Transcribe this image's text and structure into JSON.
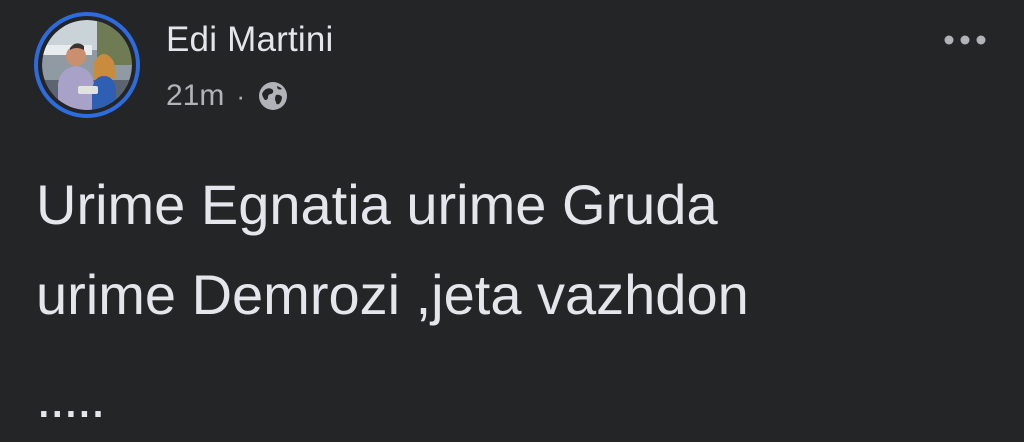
{
  "post": {
    "author": {
      "name": "Edi Martini",
      "avatar_icon": "profile-photo"
    },
    "meta": {
      "time": "21m",
      "separator": "·",
      "audience_icon": "globe-icon"
    },
    "more_icon": "more-horizontal-icon",
    "text_line1": "Urime Egnatia urime Gruda",
    "text_line2": "urime Demrozi ,jeta vazhdon",
    "trailing": "....."
  },
  "colors": {
    "background": "#242526",
    "text_primary": "#e4e6eb",
    "text_secondary": "#b0b3b8",
    "story_ring": "#2d6cdf"
  }
}
